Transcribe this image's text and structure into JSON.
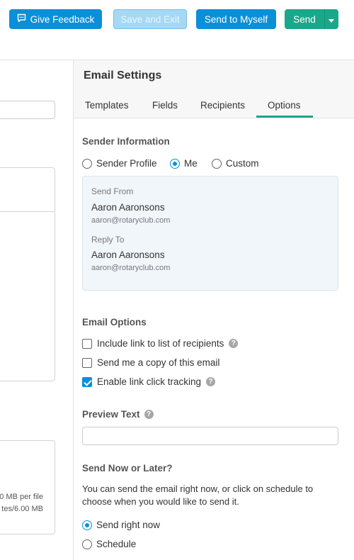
{
  "toolbar": {
    "feedback_label": "Give Feedback",
    "feedback_icon": "feedback-icon",
    "save_exit_label": "Save and Exit",
    "send_myself_label": "Send to Myself",
    "send_label": "Send",
    "send_dropdown_icon": "caret-down-icon"
  },
  "left_panel": {
    "attachments_limit_1": "0 MB per file",
    "attachments_limit_2": "tes/6.00 MB"
  },
  "settings": {
    "title": "Email Settings",
    "tabs": [
      {
        "label": "Templates"
      },
      {
        "label": "Fields"
      },
      {
        "label": "Recipients"
      },
      {
        "label": "Options",
        "active": true
      }
    ],
    "sender": {
      "title": "Sender Information",
      "options": [
        {
          "label": "Sender Profile",
          "selected": false
        },
        {
          "label": "Me",
          "selected": true
        },
        {
          "label": "Custom",
          "selected": false
        }
      ],
      "send_from_label": "Send From",
      "send_from_name": "Aaron Aaronsons",
      "send_from_email": "aaron@rotaryclub.com",
      "reply_to_label": "Reply To",
      "reply_to_name": "Aaron Aaronsons",
      "reply_to_email": "aaron@rotaryclub.com"
    },
    "email_options": {
      "title": "Email Options",
      "items": [
        {
          "label": "Include link to list of recipients",
          "checked": false,
          "help": true
        },
        {
          "label": "Send me a copy of this email",
          "checked": false,
          "help": false
        },
        {
          "label": "Enable link click tracking",
          "checked": true,
          "help": true
        }
      ]
    },
    "preview": {
      "title": "Preview Text",
      "value": ""
    },
    "schedule": {
      "title": "Send Now or Later?",
      "description": "You can send the email right now, or click on schedule to choose when you would like to send it.",
      "options": [
        {
          "label": "Send right now",
          "selected": true
        },
        {
          "label": "Schedule",
          "selected": false
        }
      ]
    }
  },
  "colors": {
    "primary_blue": "#0b8fd9",
    "send_green": "#1aa88a",
    "disabled_blue": "#a6d8f3"
  }
}
